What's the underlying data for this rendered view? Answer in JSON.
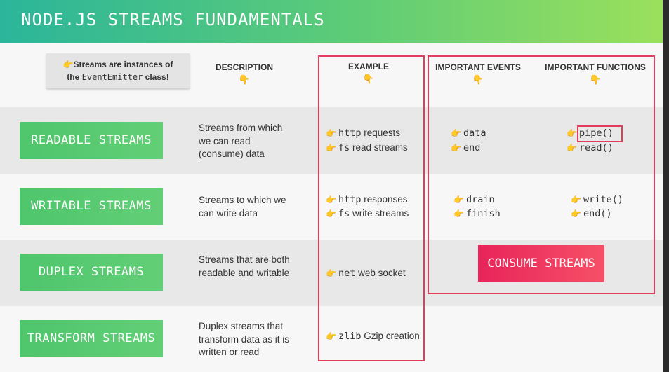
{
  "title": "NODE.JS STREAMS FUNDAMENTALS",
  "note": {
    "hand": "👉",
    "line1": "Streams are instances of",
    "line2_pre": "the ",
    "line2_code": "EventEmitter",
    "line2_post": " class!"
  },
  "headers": {
    "description": "DESCRIPTION",
    "example": "EXAMPLE",
    "events": "IMPORTANT EVENTS",
    "functions": "IMPORTANT FUNCTIONS",
    "point_down": "👇"
  },
  "hand": "👉",
  "rows": [
    {
      "label": "READABLE STREAMS",
      "description": "Streams from which we can read (consume) data",
      "examples": [
        {
          "code": "http",
          "text": " requests"
        },
        {
          "code": "fs",
          "text": " read streams"
        }
      ],
      "events": [
        "data",
        "end"
      ],
      "functions": [
        "pipe()",
        "read()"
      ]
    },
    {
      "label": "WRITABLE  STREAMS",
      "description": "Streams to which we can write data",
      "examples": [
        {
          "code": "http",
          "text": " responses"
        },
        {
          "code": "fs",
          "text": " write streams"
        }
      ],
      "events": [
        "drain",
        "finish"
      ],
      "functions": [
        "write()",
        "end()"
      ]
    },
    {
      "label": "DUPLEX  STREAMS",
      "description": "Streams that are both readable and writable",
      "examples": [
        {
          "code": "net",
          "text": " web socket"
        }
      ]
    },
    {
      "label": "TRANSFORM  STREAMS",
      "description": "Duplex streams that transform data as it is written or read",
      "examples": [
        {
          "code": "zlib",
          "text": " Gzip creation"
        }
      ]
    }
  ],
  "consume_button": "CONSUME STREAMS",
  "colors": {
    "accent_green": "#5fcd76",
    "accent_red": "#e23c5c",
    "header_gradient_start": "#2bb59a",
    "header_gradient_end": "#9be05c"
  }
}
